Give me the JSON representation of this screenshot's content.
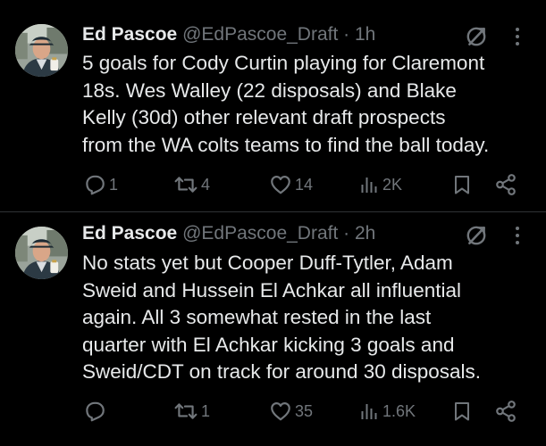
{
  "tweets": [
    {
      "author": {
        "name": "Ed Pascoe",
        "handle": "@EdPascoe_Draft",
        "separator": "·",
        "time": "1h",
        "avatar": "avatar-photo"
      },
      "text": "5 goals for Cody Curtin playing for Claremont\n18s. Wes Walley (22 disposals) and Blake\nKelly (30d) other relevant draft prospects\nfrom the WA colts teams to find the ball today.",
      "stats": {
        "replies": "1",
        "reposts": "4",
        "likes": "14",
        "views": "2K"
      }
    },
    {
      "author": {
        "name": "Ed Pascoe",
        "handle": "@EdPascoe_Draft",
        "separator": "·",
        "time": "2h",
        "avatar": "avatar-photo"
      },
      "text": "No stats yet but Cooper Duff-Tytler, Adam\nSweid and Hussein El Achkar all influential\nagain. All 3 somewhat rested in the last\nquarter with El Achkar kicking 3 goals and\nSweid/CDT on track for around 30 disposals.",
      "stats": {
        "replies": "",
        "reposts": "1",
        "likes": "35",
        "views": "1.6K"
      }
    }
  ],
  "icons": {
    "reply": "reply-icon",
    "repost": "repost-icon",
    "like": "like-icon",
    "views": "views-icon",
    "bookmark": "bookmark-icon",
    "share": "share-icon",
    "grok": "grok-icon",
    "more": "more-icon"
  },
  "colors": {
    "background": "#000000",
    "text": "#e7e9ea",
    "secondary": "#71767b",
    "divider": "#2f3336"
  }
}
